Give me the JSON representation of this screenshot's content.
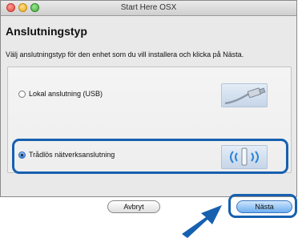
{
  "window": {
    "title": "Start Here OSX"
  },
  "page": {
    "heading": "Anslutningstyp",
    "instruction": "Välj anslutningstyp för den enhet som du vill installera och klicka på Nästa."
  },
  "options": [
    {
      "label": "Lokal anslutning (USB)",
      "selected": false,
      "icon": "usb-cable-icon"
    },
    {
      "label": "Trådlös nätverksanslutning",
      "selected": true,
      "icon": "wireless-signal-icon"
    }
  ],
  "buttons": {
    "cancel": "Avbryt",
    "next": "Nästa"
  },
  "colors": {
    "highlight": "#1660b0",
    "primary_button": "#6eaef0",
    "window_background": "#e9e9e9"
  }
}
